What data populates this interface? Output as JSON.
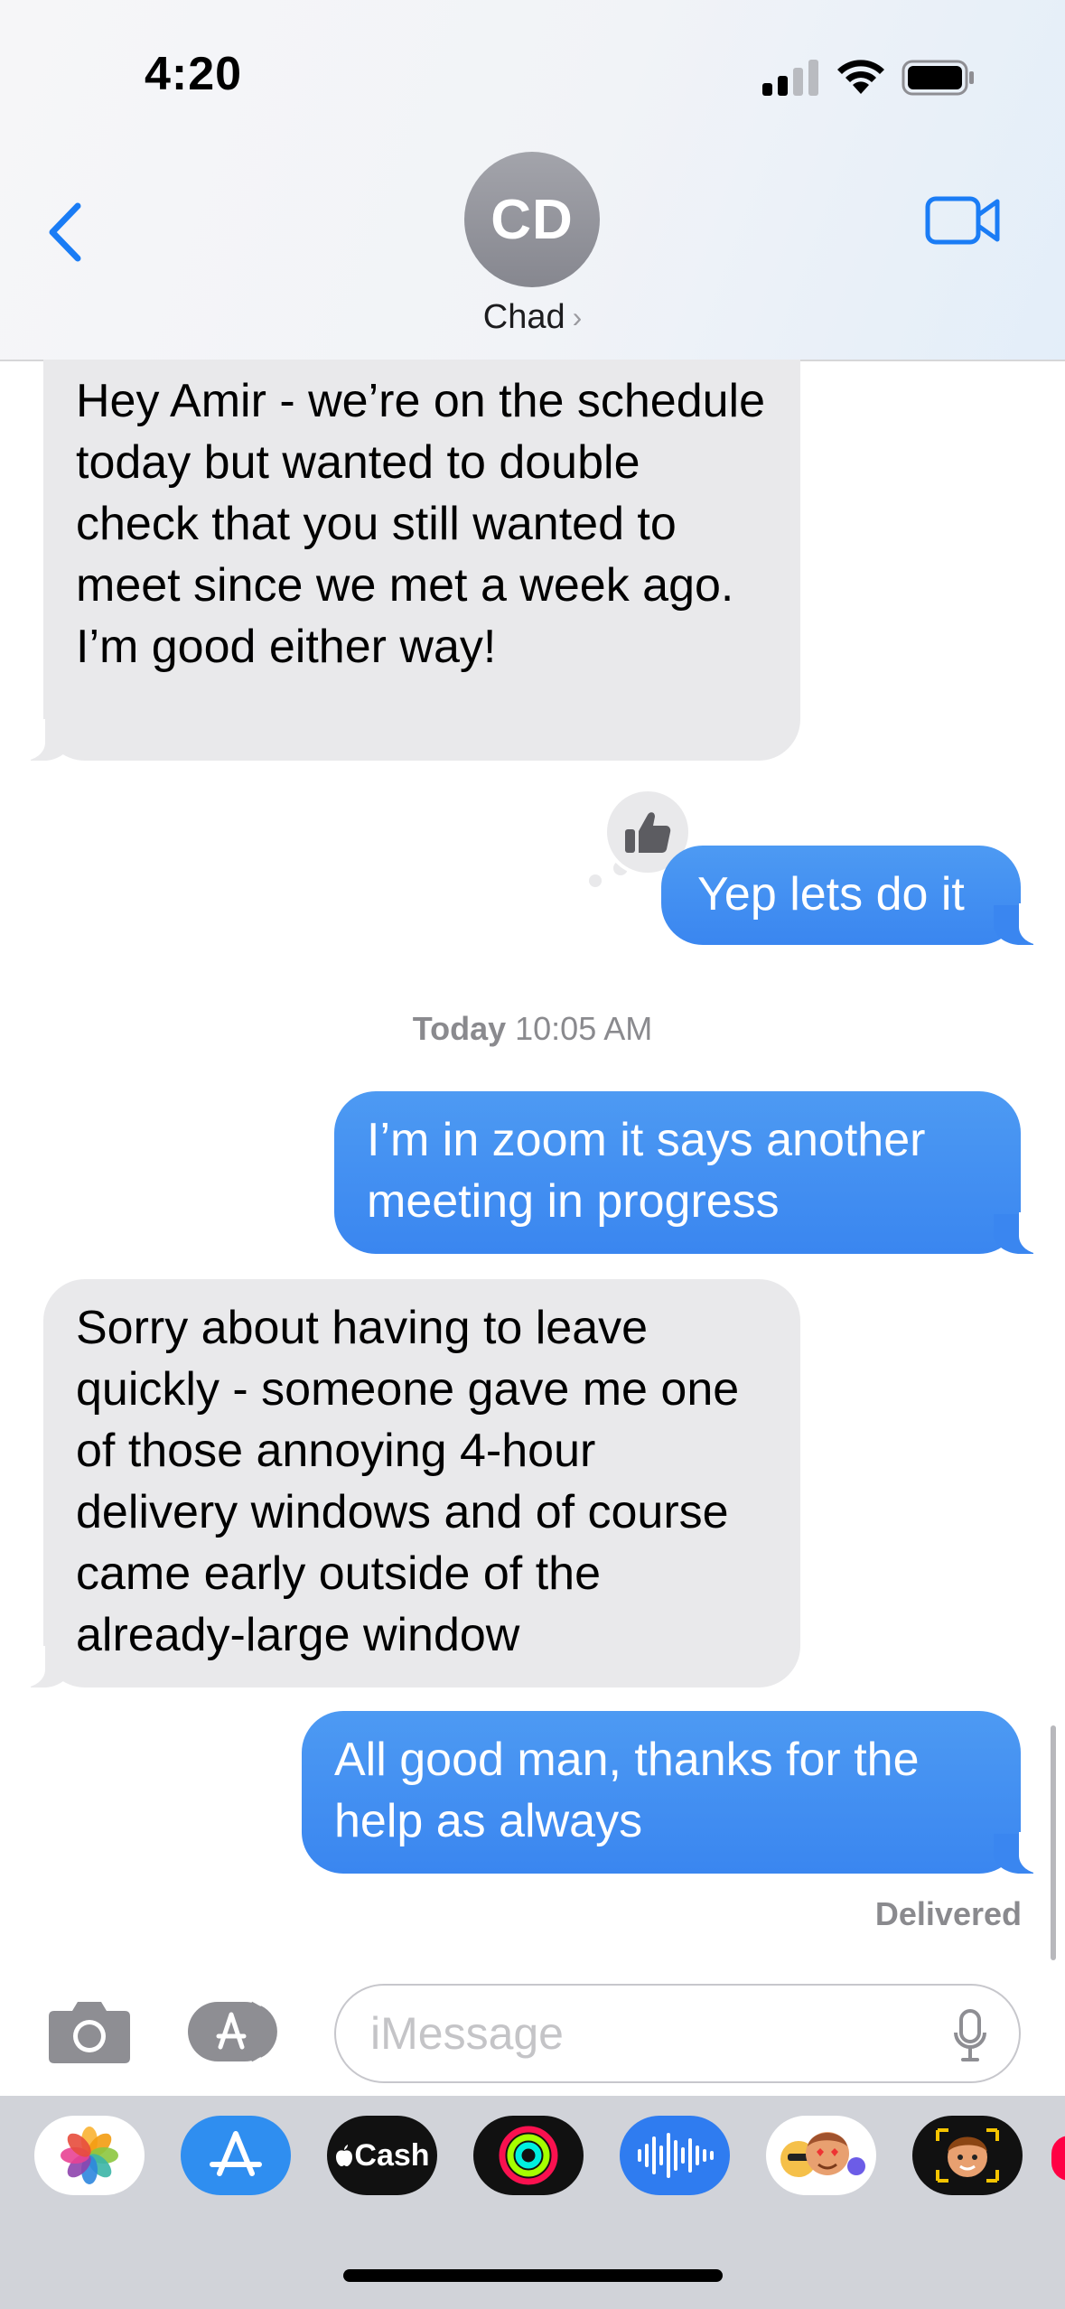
{
  "status_bar": {
    "time": "4:20"
  },
  "header": {
    "avatar_initials": "CD",
    "contact_name": "Chad",
    "chevron": "›"
  },
  "messages": [
    {
      "direction": "incoming",
      "text": "Hey Amir - we’re on the schedule today but wanted to double check that you still wanted to meet since we met a week ago. I’m good either way!"
    },
    {
      "direction": "outgoing",
      "text": "Yep lets do it",
      "reaction": "thumbs-up-icon"
    },
    {
      "direction": "outgoing",
      "text": "I’m in zoom it says another meeting in progress"
    },
    {
      "direction": "incoming",
      "text": "Sorry about having to leave quickly - someone gave me one of those annoying 4-hour delivery windows and of course came early outside of the already-large window"
    },
    {
      "direction": "outgoing",
      "text": "All good man, thanks for the help as always"
    }
  ],
  "timestamp": {
    "day": "Today",
    "time": "10:05 AM"
  },
  "delivery_status": "Delivered",
  "input": {
    "placeholder": "iMessage"
  },
  "app_drawer": {
    "items": [
      "photos-icon",
      "app-store-icon",
      "cash-app-icon",
      "fitness-icon",
      "audio-message-icon",
      "memoji-stickers-icon",
      "memoji-icon"
    ],
    "cash_label": "Cash"
  },
  "colors": {
    "outgoing_bubble": "#3a86f0",
    "incoming_bubble": "#e9e9eb",
    "accent": "#1a7cf5"
  }
}
